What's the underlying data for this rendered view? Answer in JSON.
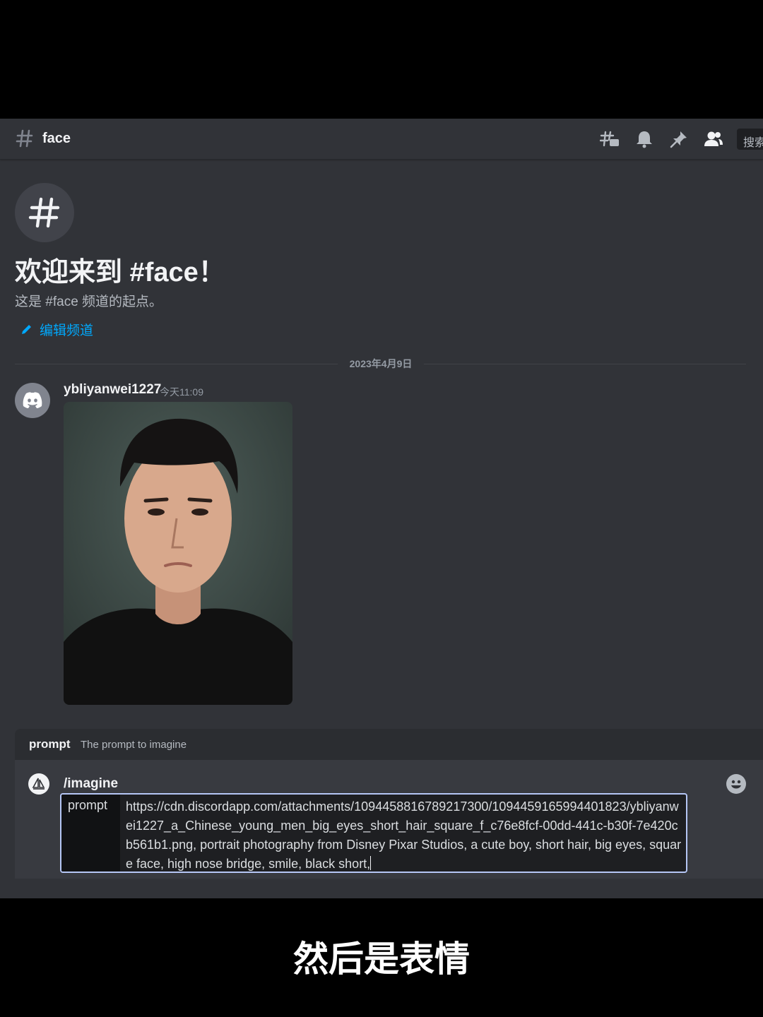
{
  "header": {
    "channel_name": "face",
    "search_placeholder": "搜索",
    "icons": [
      "threads-icon",
      "bell-icon",
      "pin-icon",
      "members-icon"
    ]
  },
  "welcome": {
    "title": "欢迎来到 #face！",
    "subtitle": "这是 #face 频道的起点。",
    "edit_label": "编辑频道"
  },
  "divider": {
    "date": "2023年4月9日"
  },
  "message": {
    "username": "ybliyanwei1227",
    "timestamp": "今天11:09",
    "avatar_icon": "discord-logo-icon"
  },
  "prompt_hint": {
    "option_name": "prompt",
    "description": "The prompt to imagine"
  },
  "composer": {
    "command": "/imagine",
    "option_label": "prompt",
    "option_value": "https://cdn.discordapp.com/attachments/1094458816789217300/1094459165994401823/ybliyanwei1227_a_Chinese_young_men_big_eyes_short_hair_square_f_c76e8fcf-00dd-441c-b30f-7e420cb561b1.png, portrait photography from Disney Pixar Studios, a cute boy, short hair, big eyes, square face, high nose bridge, smile, black short,"
  },
  "caption": "然后是表情",
  "colors": {
    "background": "#313338",
    "link": "#00a8fc",
    "input_border": "#b5c6f5"
  }
}
